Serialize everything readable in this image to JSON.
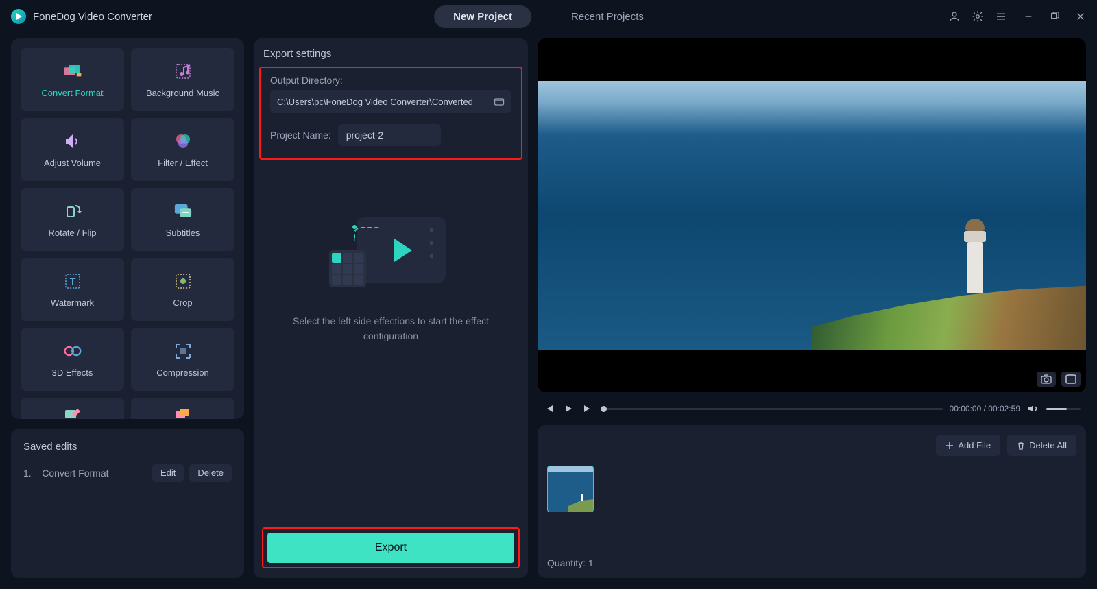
{
  "app": {
    "title": "FoneDog Video Converter"
  },
  "tabs": {
    "new_project": "New Project",
    "recent_projects": "Recent Projects"
  },
  "tools": {
    "convert_format": "Convert Format",
    "background_music": "Background Music",
    "adjust_volume": "Adjust Volume",
    "filter_effect": "Filter / Effect",
    "rotate_flip": "Rotate / Flip",
    "subtitles": "Subtitles",
    "watermark": "Watermark",
    "crop": "Crop",
    "three_d_effects": "3D Effects",
    "compression": "Compression"
  },
  "saved": {
    "title": "Saved edits",
    "items": [
      {
        "index": "1.",
        "name": "Convert Format"
      }
    ],
    "edit": "Edit",
    "delete": "Delete"
  },
  "export": {
    "title": "Export settings",
    "output_dir_label": "Output Directory:",
    "output_dir_value": "C:\\Users\\pc\\FoneDog Video Converter\\Converted",
    "project_name_label": "Project Name:",
    "project_name_value": "project-2",
    "placeholder_text": "Select the left side effections to start the effect configuration",
    "button": "Export"
  },
  "player": {
    "current_time": "00:00:00",
    "total_time": "00:02:59"
  },
  "files": {
    "add_file": "Add File",
    "delete_all": "Delete All",
    "quantity_label": "Quantity:",
    "quantity_value": "1"
  }
}
